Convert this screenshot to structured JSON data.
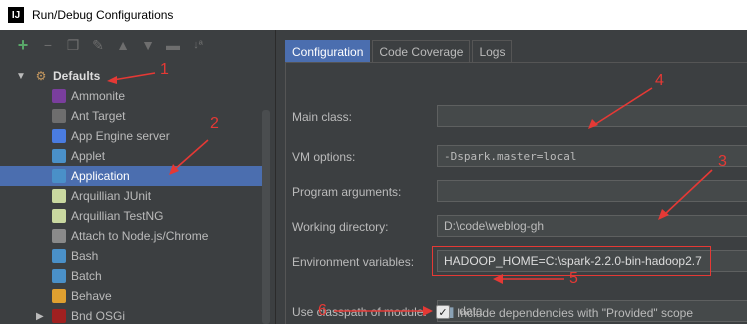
{
  "window": {
    "title": "Run/Debug Configurations",
    "icon_letter": "IJ"
  },
  "toolbar": {
    "icons": [
      "add-icon",
      "remove-icon",
      "copy-icon",
      "wrench-icon",
      "move-up-icon",
      "move-down-icon",
      "folder-icon",
      "sort-icon"
    ]
  },
  "tree": {
    "root_label": "Defaults",
    "items": [
      {
        "label": "Ammonite",
        "icon": "ammonite-icon",
        "color": "#7a3e9d"
      },
      {
        "label": "Ant Target",
        "icon": "ant-icon",
        "color": "#6e6e6e"
      },
      {
        "label": "App Engine server",
        "icon": "appengine-icon",
        "color": "#4a7ce0"
      },
      {
        "label": "Applet",
        "icon": "applet-icon",
        "color": "#4a90c8"
      },
      {
        "label": "Application",
        "icon": "application-icon",
        "color": "#4a90c8",
        "selected": true
      },
      {
        "label": "Arquillian JUnit",
        "icon": "arquillian-icon",
        "color": "#c9d8a0"
      },
      {
        "label": "Arquillian TestNG",
        "icon": "arquillian-icon",
        "color": "#c9d8a0"
      },
      {
        "label": "Attach to Node.js/Chrome",
        "icon": "nodejs-icon",
        "color": "#8a8a8a"
      },
      {
        "label": "Bash",
        "icon": "bash-icon",
        "color": "#4a90c8"
      },
      {
        "label": "Batch",
        "icon": "batch-icon",
        "color": "#4a90c8"
      },
      {
        "label": "Behave",
        "icon": "behave-icon",
        "color": "#e0a030"
      },
      {
        "label": "Bnd OSGi",
        "icon": "bnd-icon",
        "color": "#a02020"
      }
    ]
  },
  "tabs": [
    {
      "label": "Configuration",
      "active": true
    },
    {
      "label": "Code Coverage",
      "active": false
    },
    {
      "label": "Logs",
      "active": false
    }
  ],
  "form": {
    "main_class_label": "Main class:",
    "main_class_value": "",
    "vm_options_label": "VM options:",
    "vm_options_value": "-Dspark.master=local",
    "program_args_label": "Program arguments:",
    "program_args_value": "",
    "working_dir_label": "Working directory:",
    "working_dir_value": "D:\\code\\weblog-gh",
    "env_vars_label": "Environment variables:",
    "env_vars_value": "HADOOP_HOME=C:\\spark-2.2.0-bin-hadoop2.7",
    "classpath_label": "Use classpath of module:",
    "classpath_value": "data",
    "include_deps_label": "Include dependencies with \"Provided\" scope",
    "include_deps_checked": true
  },
  "annotations": [
    "1",
    "2",
    "3",
    "4",
    "5",
    "6"
  ],
  "colors": {
    "selection": "#4b6eaf",
    "annotation": "#e53935",
    "background": "#3c3f41"
  }
}
